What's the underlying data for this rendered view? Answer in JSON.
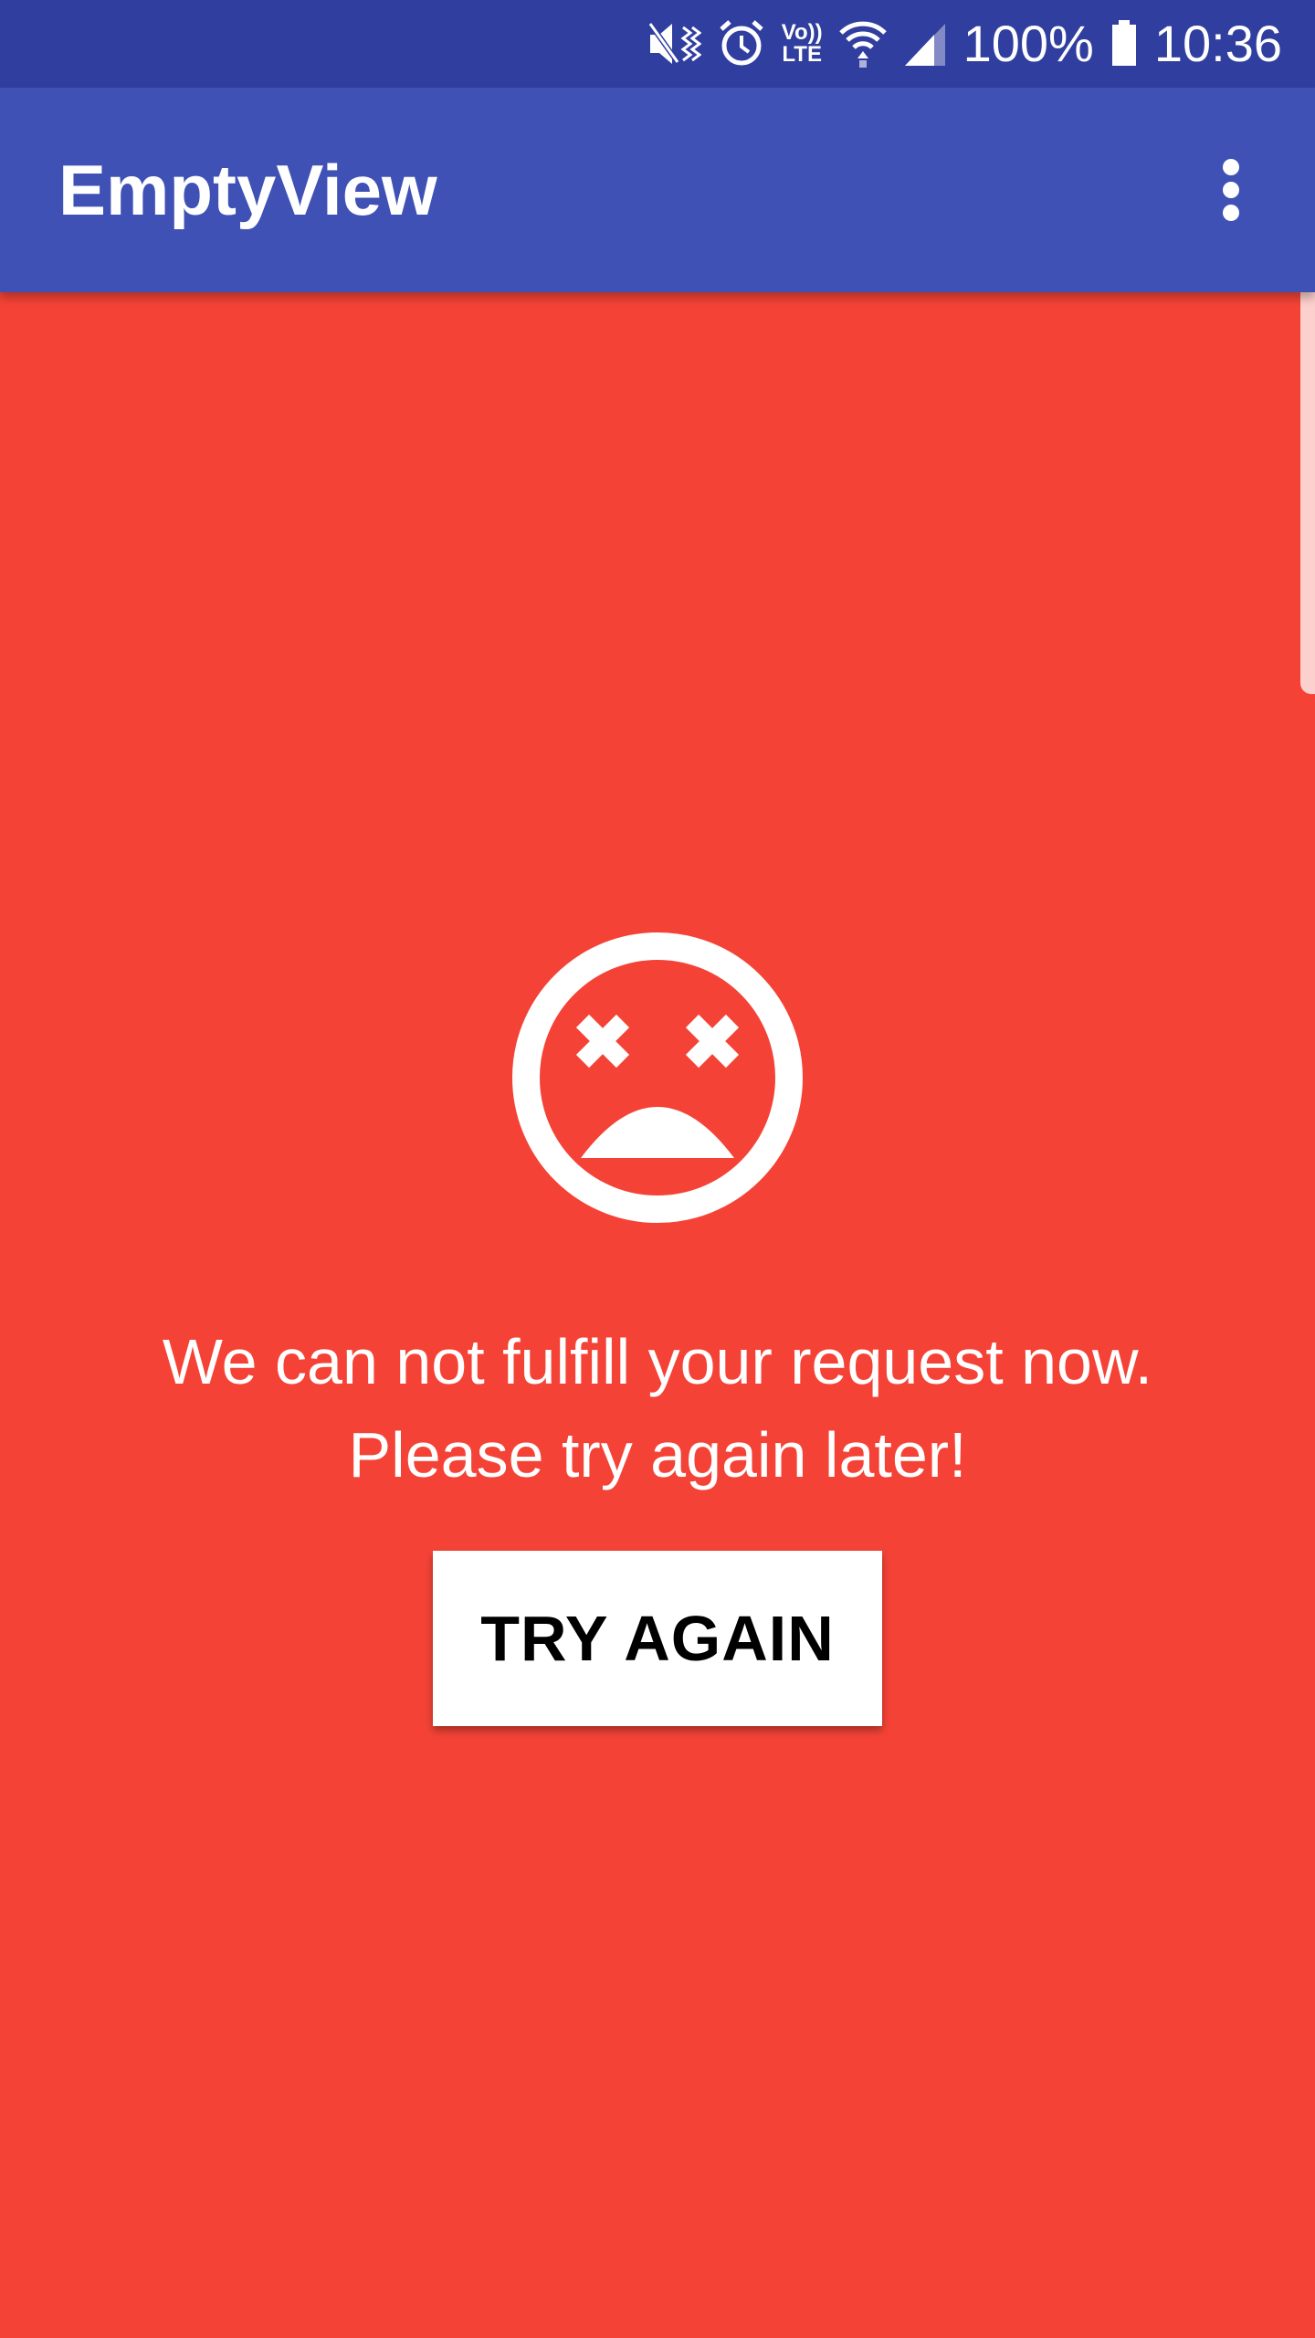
{
  "status_bar": {
    "battery_percent": "100%",
    "time": "10:36",
    "volte_top": "Vo))",
    "volte_bottom": "LTE",
    "icons": [
      "mute-vibrate-icon",
      "alarm-icon",
      "volte-icon",
      "wifi-icon",
      "signal-icon",
      "battery-icon"
    ]
  },
  "app_bar": {
    "title": "EmptyView",
    "menu_icon": "more-vert-icon"
  },
  "empty_state": {
    "icon": "sad-face-icon",
    "message_line1": "We can not fulfill your request now.",
    "message_line2": "Please try again later!",
    "button_label": "TRY AGAIN"
  },
  "colors": {
    "status_bar": "#303F9F",
    "app_bar": "#3F51B5",
    "background": "#F44336",
    "button": "#FFFFFF"
  }
}
